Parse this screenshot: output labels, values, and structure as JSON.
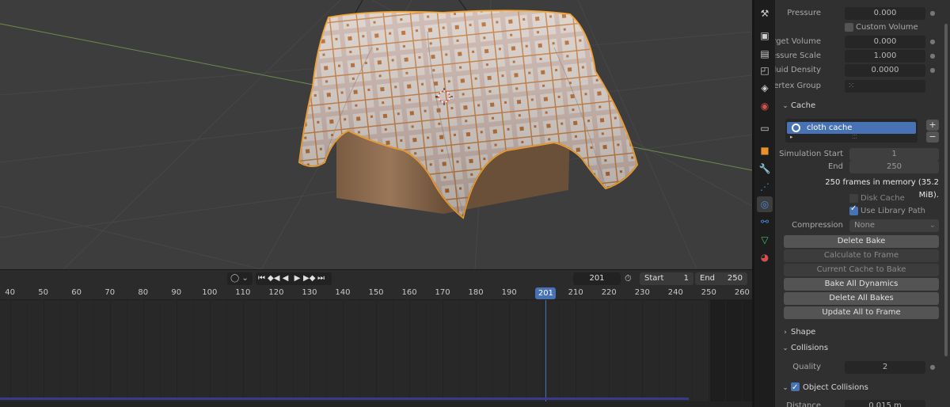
{
  "colors": {
    "accent": "#4772b3",
    "selection": "#e8902a",
    "viewport_bg": "#3d3d3d"
  },
  "timeline": {
    "keying_icon": "circle-icon",
    "transport": [
      "⏮",
      "◆◀",
      "◀",
      "▶",
      "▶◆",
      "⏭"
    ],
    "current_frame": "201",
    "start_label": "Start",
    "start_value": "1",
    "end_label": "End",
    "end_value": "250",
    "ruler_ticks": [
      "40",
      "50",
      "60",
      "70",
      "80",
      "90",
      "100",
      "110",
      "120",
      "130",
      "140",
      "150",
      "160",
      "170",
      "180",
      "190",
      "200",
      "210",
      "220",
      "230",
      "240",
      "250",
      "260"
    ],
    "playhead_label": "201",
    "visible_frame_min": 37,
    "visible_frame_max": 263,
    "playhead_frame": 201
  },
  "props": {
    "pressure_label": "Pressure",
    "pressure_value": "0.000",
    "custom_volume_label": "Custom Volume",
    "custom_volume_checked": false,
    "target_volume_label": "Target Volume",
    "target_volume_value": "0.000",
    "pressure_scale_label": "Pressure Scale",
    "pressure_scale_value": "1.000",
    "fluid_density_label": "Fluid Density",
    "fluid_density_value": "0.0000",
    "vertex_group_label": "Vertex Group",
    "cache": {
      "header": "Cache",
      "list_item": "cloth cache",
      "sim_start_label": "Simulation Start",
      "sim_start_value": "1",
      "end_label": "End",
      "end_value": "250",
      "memory_info": "250 frames in memory (35.2 MiB).",
      "disk_cache_label": "Disk Cache",
      "disk_cache_checked": false,
      "use_library_path_label": "Use Library Path",
      "use_library_path_checked": true,
      "compression_label": "Compression",
      "compression_value": "None",
      "buttons": {
        "delete_bake": "Delete Bake",
        "calculate_to_frame": "Calculate to Frame",
        "current_cache_to_bake": "Current Cache to Bake",
        "bake_all_dynamics": "Bake All Dynamics",
        "delete_all_bakes": "Delete All Bakes",
        "update_all_to_frame": "Update All to Frame"
      }
    },
    "shape_header": "Shape",
    "collisions_header": "Collisions",
    "quality_label": "Quality",
    "quality_value": "2",
    "object_collisions_label": "Object Collisions",
    "object_collisions_checked": true,
    "distance_label": "Distance",
    "distance_value": "0.015 m"
  },
  "tabs": [
    {
      "icon": "tool-icon",
      "glyph": "⚒",
      "color": "#d0d0d0"
    },
    {
      "icon": "render-icon",
      "glyph": "▣",
      "color": "#d0d0d0"
    },
    {
      "icon": "output-icon",
      "glyph": "▤",
      "color": "#d0d0d0"
    },
    {
      "icon": "view-layer-icon",
      "glyph": "◰",
      "color": "#d0d0d0"
    },
    {
      "icon": "scene-icon",
      "glyph": "◈",
      "color": "#d0d0d0"
    },
    {
      "icon": "world-icon",
      "glyph": "◉",
      "color": "#d05050"
    },
    {
      "icon": "collection-icon",
      "glyph": "▭",
      "color": "#d0d0d0"
    },
    {
      "icon": "object-icon",
      "glyph": "■",
      "color": "#e8902a"
    },
    {
      "icon": "modifier-icon",
      "glyph": "🔧",
      "color": "#4a8ade"
    },
    {
      "icon": "particles-icon",
      "glyph": "⋰",
      "color": "#4a8ade"
    },
    {
      "icon": "physics-icon",
      "glyph": "◎",
      "color": "#4a8ade"
    },
    {
      "icon": "constraints-icon",
      "glyph": "⚯",
      "color": "#4a8ade"
    },
    {
      "icon": "data-icon",
      "glyph": "▽",
      "color": "#40c060"
    },
    {
      "icon": "material-icon",
      "glyph": "◕",
      "color": "#d05050"
    }
  ]
}
